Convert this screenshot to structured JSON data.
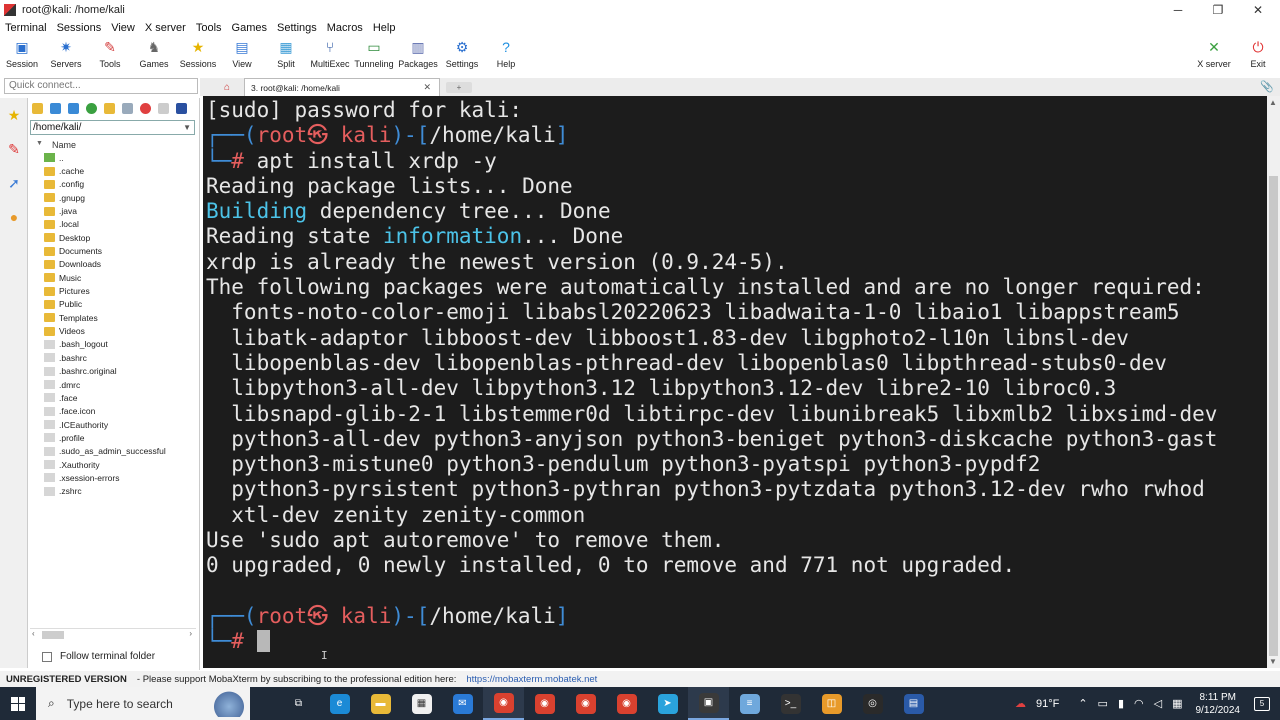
{
  "window": {
    "title": "root@kali: /home/kali"
  },
  "menu": [
    "Terminal",
    "Sessions",
    "View",
    "X server",
    "Tools",
    "Games",
    "Settings",
    "Macros",
    "Help"
  ],
  "toolbar": {
    "left": [
      {
        "label": "Session",
        "icon": "session-icon",
        "color": "#2a6fcf",
        "glyph": "▣"
      },
      {
        "label": "Servers",
        "icon": "servers-icon",
        "color": "#2a6fcf",
        "glyph": "✷"
      },
      {
        "label": "Tools",
        "icon": "tools-icon",
        "color": "#d33b3b",
        "glyph": "✎"
      },
      {
        "label": "Games",
        "icon": "games-icon",
        "color": "#666666",
        "glyph": "♞"
      },
      {
        "label": "Sessions",
        "icon": "star-icon",
        "color": "#e6b400",
        "glyph": "★"
      },
      {
        "label": "View",
        "icon": "view-icon",
        "color": "#3a7bd5",
        "glyph": "▤"
      },
      {
        "label": "Split",
        "icon": "split-icon",
        "color": "#3a9bd5",
        "glyph": "▦"
      },
      {
        "label": "MultiExec",
        "icon": "multiexec-icon",
        "color": "#2350a0",
        "glyph": "⑂"
      },
      {
        "label": "Tunneling",
        "icon": "tunneling-icon",
        "color": "#2d8a3a",
        "glyph": "▭"
      },
      {
        "label": "Packages",
        "icon": "packages-icon",
        "color": "#5566aa",
        "glyph": "▥"
      },
      {
        "label": "Settings",
        "icon": "gear-icon",
        "color": "#2a6fcf",
        "glyph": "⚙"
      },
      {
        "label": "Help",
        "icon": "help-icon",
        "color": "#1e8fe0",
        "glyph": "?"
      }
    ],
    "right": [
      {
        "label": "X server",
        "icon": "xserver-icon",
        "color": "#3aa040",
        "glyph": "✕"
      },
      {
        "label": "Exit",
        "icon": "power-icon",
        "color": "#e03030",
        "glyph": "⏻"
      }
    ]
  },
  "quick_connect": {
    "placeholder": "Quick connect..."
  },
  "filebrowser": {
    "path": "/home/kali/",
    "column": "Name",
    "follow_label": "Follow terminal folder",
    "items": [
      {
        "name": "..",
        "type": "updir"
      },
      {
        "name": ".cache",
        "type": "folder"
      },
      {
        "name": ".config",
        "type": "folder"
      },
      {
        "name": ".gnupg",
        "type": "folder"
      },
      {
        "name": ".java",
        "type": "folder"
      },
      {
        "name": ".local",
        "type": "folder"
      },
      {
        "name": "Desktop",
        "type": "folder"
      },
      {
        "name": "Documents",
        "type": "folder"
      },
      {
        "name": "Downloads",
        "type": "folder"
      },
      {
        "name": "Music",
        "type": "folder"
      },
      {
        "name": "Pictures",
        "type": "folder"
      },
      {
        "name": "Public",
        "type": "folder"
      },
      {
        "name": "Templates",
        "type": "folder"
      },
      {
        "name": "Videos",
        "type": "folder"
      },
      {
        "name": ".bash_logout",
        "type": "file"
      },
      {
        "name": ".bashrc",
        "type": "file"
      },
      {
        "name": ".bashrc.original",
        "type": "file"
      },
      {
        "name": ".dmrc",
        "type": "file"
      },
      {
        "name": ".face",
        "type": "file"
      },
      {
        "name": ".face.icon",
        "type": "file"
      },
      {
        "name": ".ICEauthority",
        "type": "file"
      },
      {
        "name": ".profile",
        "type": "file"
      },
      {
        "name": ".sudo_as_admin_successful",
        "type": "file"
      },
      {
        "name": ".Xauthority",
        "type": "file"
      },
      {
        "name": ".xsession-errors",
        "type": "file"
      },
      {
        "name": ".zshrc",
        "type": "file"
      }
    ]
  },
  "tabs": {
    "active_label": "3. root@kali: /home/kali"
  },
  "terminal": {
    "lines": [
      [
        [
          "[sudo] password for kali:",
          ""
        ]
      ],
      [
        [
          "┌──(",
          "c-blue"
        ],
        [
          "root㉿ kali",
          "c-red"
        ],
        [
          ")-[",
          "c-blue"
        ],
        [
          "/home/kali",
          ""
        ],
        [
          "]",
          "c-blue"
        ]
      ],
      [
        [
          "└─",
          "c-blue"
        ],
        [
          "#",
          "c-red"
        ],
        [
          " apt install xrdp -y",
          ""
        ]
      ],
      [
        [
          "Reading package lists... Done",
          ""
        ]
      ],
      [
        [
          "Building",
          "c-cyan"
        ],
        [
          " dependency tree... Done",
          ""
        ]
      ],
      [
        [
          "Reading state ",
          ""
        ],
        [
          "information",
          "c-cyan"
        ],
        [
          "... Done",
          ""
        ]
      ],
      [
        [
          "xrdp is already the newest version (0.9.24-5).",
          ""
        ]
      ],
      [
        [
          "The following packages were automatically installed and are no longer required:",
          ""
        ]
      ],
      [
        [
          "  fonts-noto-color-emoji libabsl20220623 libadwaita-1-0 libaio1 libappstream5",
          ""
        ]
      ],
      [
        [
          "  libatk-adaptor libboost-dev libboost1.83-dev libgphoto2-l10n libnsl-dev",
          ""
        ]
      ],
      [
        [
          "  libopenblas-dev libopenblas-pthread-dev libopenblas0 libpthread-stubs0-dev",
          ""
        ]
      ],
      [
        [
          "  libpython3-all-dev libpython3.12 libpython3.12-dev libre2-10 libroc0.3",
          ""
        ]
      ],
      [
        [
          "  libsnapd-glib-2-1 libstemmer0d libtirpc-dev libunibreak5 libxmlb2 libxsimd-dev",
          ""
        ]
      ],
      [
        [
          "  python3-all-dev python3-anyjson python3-beniget python3-diskcache python3-gast",
          ""
        ]
      ],
      [
        [
          "  python3-mistune0 python3-pendulum python3-pyatspi python3-pypdf2",
          ""
        ]
      ],
      [
        [
          "  python3-pyrsistent python3-pythran python3-pytzdata python3.12-dev rwho rwhod",
          ""
        ]
      ],
      [
        [
          "  xtl-dev zenity zenity-common",
          ""
        ]
      ],
      [
        [
          "Use 'sudo apt autoremove' to remove them.",
          ""
        ]
      ],
      [
        [
          "0 upgraded, 0 newly installed, 0 to remove and 771 not upgraded.",
          ""
        ]
      ],
      [
        [
          "",
          ""
        ]
      ],
      [
        [
          "┌──(",
          "c-blue"
        ],
        [
          "root㉿ kali",
          "c-red"
        ],
        [
          ")-[",
          "c-blue"
        ],
        [
          "/home/kali",
          ""
        ],
        [
          "]",
          "c-blue"
        ]
      ],
      [
        [
          "└─",
          "c-blue"
        ],
        [
          "#",
          "c-red"
        ],
        [
          " ",
          ""
        ]
      ]
    ]
  },
  "statusbar": {
    "unregistered": "UNREGISTERED VERSION",
    "message": "-  Please support MobaXterm by subscribing to the professional edition here:",
    "link": "https://mobaxterm.mobatek.net"
  },
  "taskbar": {
    "search_placeholder": "Type here to search",
    "apps": [
      {
        "name": "task-view-icon",
        "color": "#1f2a38",
        "glyph": "⧉"
      },
      {
        "name": "edge-icon",
        "color": "#1b8ad6",
        "glyph": "e"
      },
      {
        "name": "file-explorer-icon",
        "color": "#e8b938",
        "glyph": "▬"
      },
      {
        "name": "store-icon",
        "color": "#f0f0f0",
        "glyph": "▦"
      },
      {
        "name": "mail-icon",
        "color": "#2a7ad6",
        "glyph": "✉"
      },
      {
        "name": "chrome-icon",
        "color": "#d9412f",
        "glyph": "◉"
      },
      {
        "name": "chrome-icon",
        "color": "#d9412f",
        "glyph": "◉"
      },
      {
        "name": "chrome-icon",
        "color": "#d9412f",
        "glyph": "◉"
      },
      {
        "name": "chrome-icon",
        "color": "#d9412f",
        "glyph": "◉"
      },
      {
        "name": "telegram-icon",
        "color": "#2aa3dc",
        "glyph": "➤"
      },
      {
        "name": "mobaxterm-icon",
        "color": "#3a3a3a",
        "glyph": "▣"
      },
      {
        "name": "notepad-icon",
        "color": "#6fa8dc",
        "glyph": "≡"
      },
      {
        "name": "terminal-icon",
        "color": "#333333",
        "glyph": ">_"
      },
      {
        "name": "app-icon",
        "color": "#e89a2a",
        "glyph": "◫"
      },
      {
        "name": "obs-icon",
        "color": "#2a2a2a",
        "glyph": "◎"
      },
      {
        "name": "remote-desktop-icon",
        "color": "#2a5aa8",
        "glyph": "▤"
      }
    ],
    "weather": "91°F",
    "time": "8:11 PM",
    "date": "9/12/2024",
    "notifications": "5"
  }
}
